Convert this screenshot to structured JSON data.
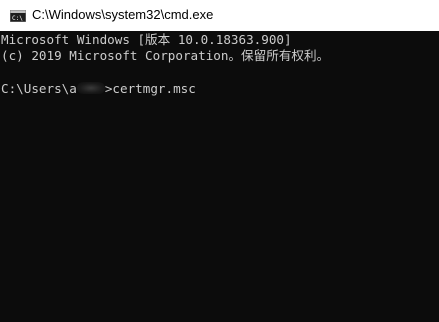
{
  "window": {
    "title": "C:\\Windows\\system32\\cmd.exe",
    "icon": "cmd-console-icon"
  },
  "console": {
    "line1": "Microsoft Windows [版本 10.0.18363.900]",
    "line2": "(c) 2019 Microsoft Corporation。保留所有权利。",
    "prompt_prefix": "C:\\Users\\a",
    "prompt_suffix": ">certmgr.msc"
  },
  "colors": {
    "console_bg": "#0c0c0c",
    "console_fg": "#cccccc",
    "titlebar_bg": "#ffffff"
  }
}
